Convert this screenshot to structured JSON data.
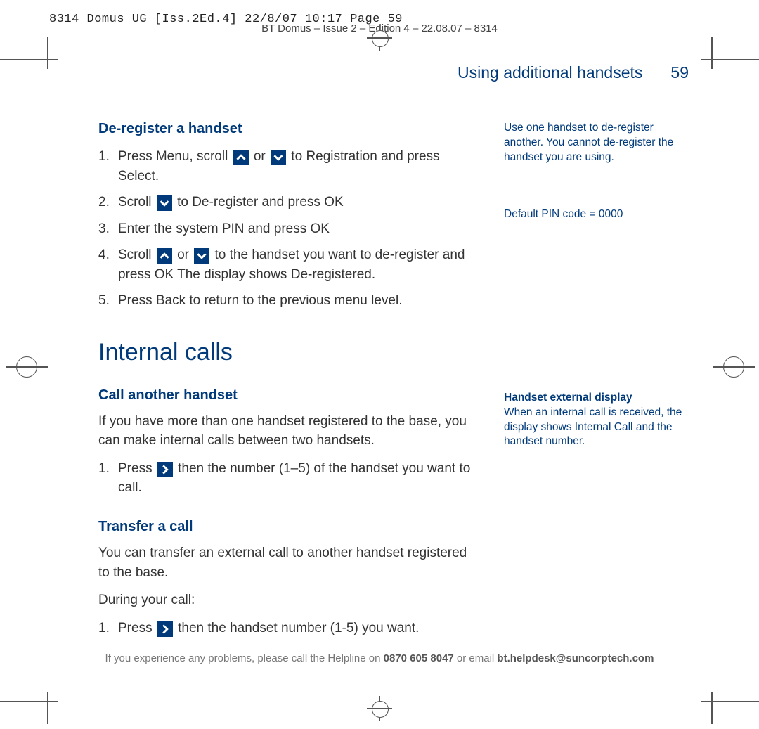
{
  "print_header": "8314 Domus UG [Iss.2Ed.4]  22/8/07  10:17  Page 59",
  "doc_header": "BT Domus – Issue 2 – Edition 4 – 22.08.07 – 8314",
  "chapter_title": "Using additional handsets",
  "page_number": "59",
  "main": {
    "dereg_title": "De-register a handset",
    "step1_a": "Press ",
    "step1_menu": "Menu",
    "step1_b": ", scroll ",
    "step1_c": " or ",
    "step1_d": " to ",
    "step1_registration": "Registration",
    "step1_e": " and press ",
    "step1_select": "Select",
    "step1_period": ".",
    "step2_a": "Scroll ",
    "step2_b": " to ",
    "step2_dereg": "De-register",
    "step2_c": " and press ",
    "step2_ok": "OK",
    "step3": "Enter the system PIN and press ",
    "step3_ok": "OK",
    "step4_a": "Scroll ",
    "step4_b": " or ",
    "step4_c": " to the handset you want to de-register and press ",
    "step4_ok": "OK",
    "step4_d": " The display shows ",
    "step4_dereg": "De-registered",
    "step4_period": ".",
    "step5_a": "Press ",
    "step5_back": "Back",
    "step5_b": " to return to the previous menu level.",
    "h2": "Internal calls",
    "call_title": "Call another handset",
    "call_desc": "If you have more than one handset registered to the base, you can make internal calls between two handsets.",
    "call_step1_a": "Press ",
    "call_step1_b": " then the number (1–5) of the handset you want to call.",
    "transfer_title": "Transfer a call",
    "transfer_desc": "You can transfer an external call to another handset registered to the base.",
    "transfer_during": "During your call:",
    "transfer_step1_a": "Press ",
    "transfer_step1_b": " then the handset number (1-5) you want."
  },
  "side": {
    "note1": "Use one handset to de-register another. You cannot de-register the handset you are using.",
    "note2": "Default PIN code = 0000",
    "note3_title": "Handset external display",
    "note3_body_a": "When an internal call is received, the display shows ",
    "note3_body_term": "Internal  Call",
    "note3_body_b": " and the handset number."
  },
  "footer": {
    "a": "If you experience any problems, please call the Helpline on ",
    "phone": "0870 605 8047",
    "b": " or email ",
    "email": "bt.helpdesk@suncorptech.com"
  }
}
